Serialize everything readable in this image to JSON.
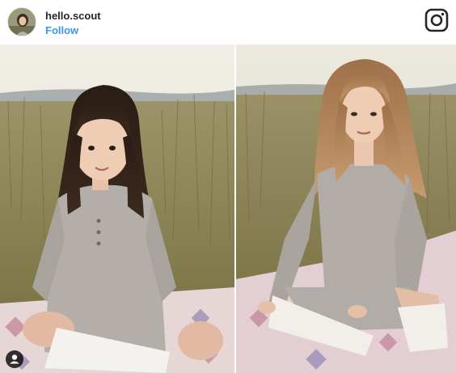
{
  "header": {
    "username": "hello.scout",
    "follow_label": "Follow"
  },
  "icons": {
    "brand": "instagram-icon",
    "tag": "user-tag-icon"
  },
  "photos": [
    {
      "name": "child-photo",
      "description_visible": false
    },
    {
      "name": "adult-photo",
      "description_visible": false
    }
  ],
  "colors": {
    "follow": "#3897f0",
    "username": "#262626"
  }
}
